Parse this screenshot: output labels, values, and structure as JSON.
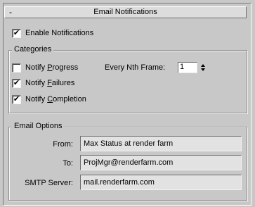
{
  "rollout": {
    "collapse_symbol": "-",
    "title": "Email Notifications"
  },
  "enable_notifications": {
    "label": "Enable Notifications",
    "checked": true,
    "check_glyph": "✔"
  },
  "categories": {
    "title": "Categories",
    "notify_progress": {
      "label_pre": "Notify ",
      "label_mnemonic": "P",
      "label_post": "rogress",
      "checked": false
    },
    "every_nth_frame": {
      "label": "Every Nth Frame:",
      "value": "1"
    },
    "notify_failures": {
      "label_pre": "Notify ",
      "label_mnemonic": "F",
      "label_post": "ailures",
      "checked": true
    },
    "notify_completion": {
      "label_pre": "Notify ",
      "label_mnemonic": "C",
      "label_post": "ompletion",
      "checked": true
    }
  },
  "email_options": {
    "title": "Email Options",
    "from": {
      "label": "From:",
      "value": "Max Status at render farm"
    },
    "to": {
      "label": "To:",
      "value": "ProjMgr@renderfarm.com"
    },
    "smtp": {
      "label": "SMTP Server:",
      "value": "mail.renderfarm.com"
    }
  }
}
